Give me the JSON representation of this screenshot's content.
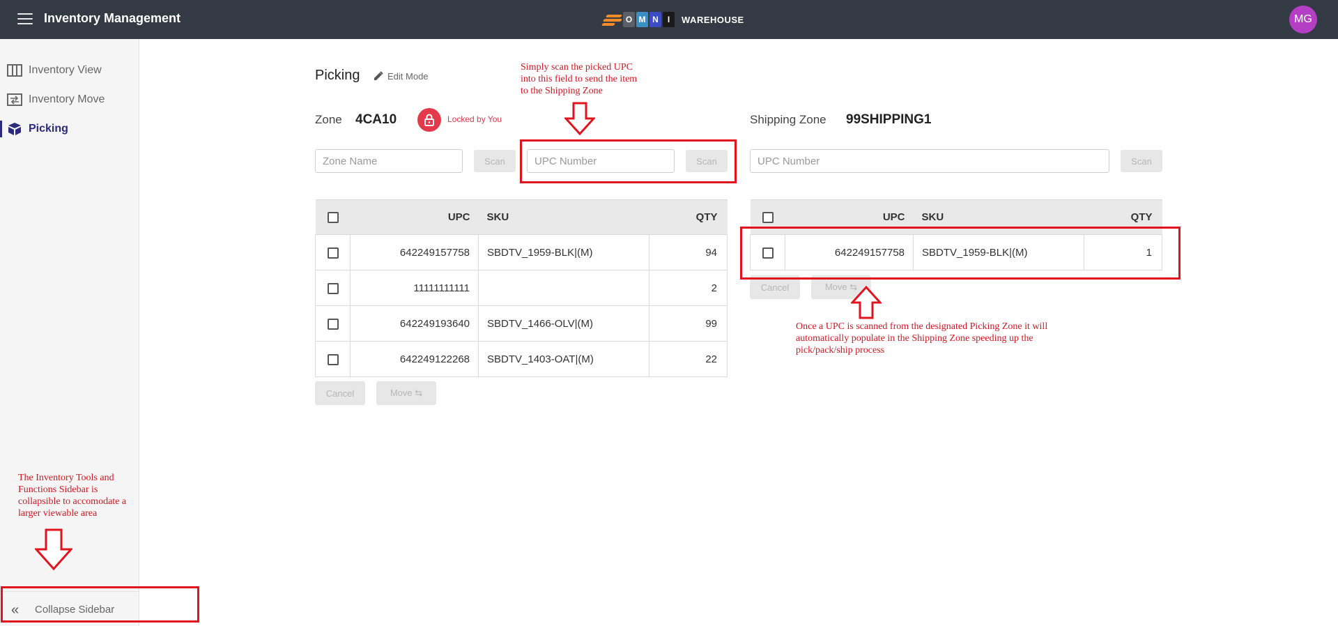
{
  "header": {
    "title": "Inventory Management",
    "logo": {
      "letters": [
        "O",
        "M",
        "N",
        "I"
      ],
      "word": "WAREHOUSE",
      "colors": [
        "#5a5f68",
        "#3b8fc2",
        "#3c4cc4",
        "#1a1a1a"
      ]
    },
    "avatar": "MG"
  },
  "sidebar": {
    "items": [
      {
        "label": "Inventory View",
        "icon": "grid-icon"
      },
      {
        "label": "Inventory Move",
        "icon": "transfer-icon"
      },
      {
        "label": "Picking",
        "icon": "boxes-icon",
        "active": true
      }
    ],
    "collapse_label": "Collapse Sidebar"
  },
  "page": {
    "title": "Picking",
    "edit_mode_label": "Edit Mode"
  },
  "picking_zone": {
    "zone_label": "Zone",
    "zone_value": "4CA10",
    "lock_status": "Locked by You",
    "zone_name_placeholder": "Zone Name",
    "scan_label": "Scan",
    "upc_placeholder": "UPC Number",
    "upc_scan_label": "Scan",
    "columns": {
      "upc": "UPC",
      "sku": "SKU",
      "qty": "QTY"
    },
    "rows": [
      {
        "upc": "642249157758",
        "sku": "SBDTV_1959-BLK|(M)",
        "qty": "94"
      },
      {
        "upc": "11111111111",
        "sku": "",
        "qty": "2"
      },
      {
        "upc": "642249193640",
        "sku": "SBDTV_1466-OLV|(M)",
        "qty": "99"
      },
      {
        "upc": "642249122268",
        "sku": "SBDTV_1403-OAT|(M)",
        "qty": "22"
      }
    ],
    "cancel_label": "Cancel",
    "move_label": "Move ⇆"
  },
  "shipping_zone": {
    "zone_label": "Shipping Zone",
    "zone_value": "99SHIPPING1",
    "upc_placeholder": "UPC Number",
    "scan_label": "Scan",
    "columns": {
      "upc": "UPC",
      "sku": "SKU",
      "qty": "QTY"
    },
    "rows": [
      {
        "upc": "642249157758",
        "sku": "SBDTV_1959-BLK|(M)",
        "qty": "1"
      }
    ],
    "cancel_label": "Cancel",
    "move_label": "Move ⇆"
  },
  "annotations": {
    "scan_note": [
      "Simply scan the picked UPC",
      "into this field to send the item",
      "to the Shipping Zone"
    ],
    "populate_note": [
      "Once a UPC is scanned from the designated Picking Zone it will",
      "automatically populate in the Shipping Zone speeding up the",
      "pick/pack/ship process"
    ],
    "sidebar_note": [
      "The Inventory Tools and",
      "Functions Sidebar is",
      "collapsible to accomodate a",
      "larger viewable area"
    ],
    "color": "#e1141e"
  }
}
